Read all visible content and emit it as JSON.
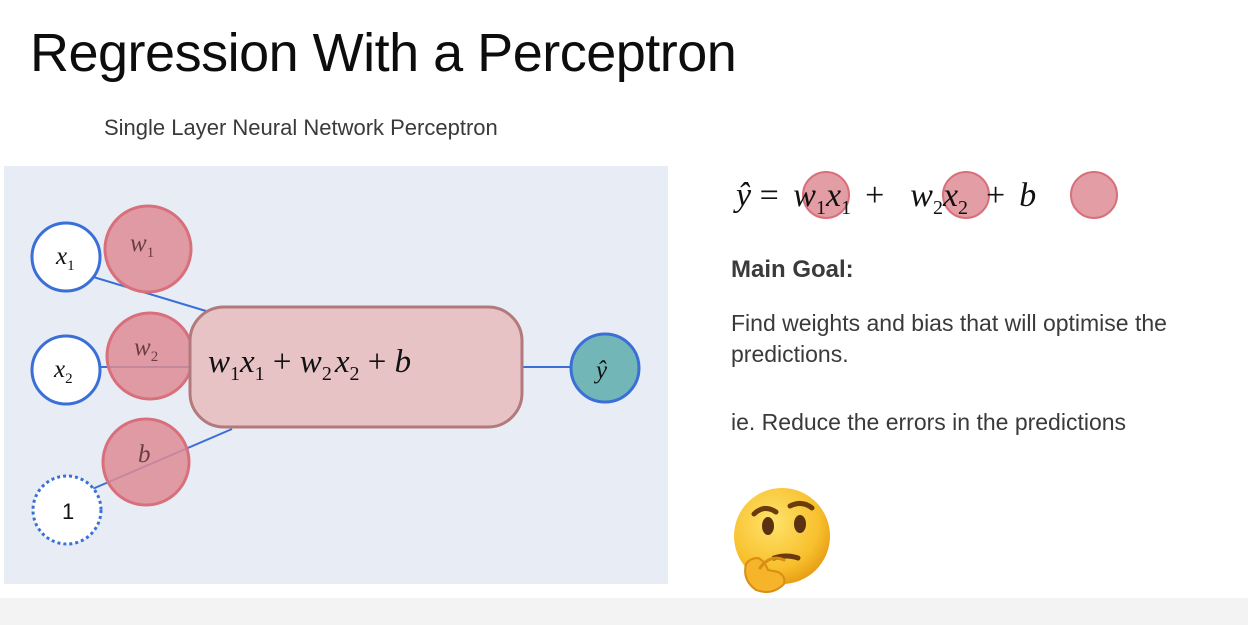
{
  "slide": {
    "title": "Regression With a Perceptron",
    "subtitle": "Single Layer Neural Network Perceptron"
  },
  "diagram": {
    "inputs": [
      {
        "base": "x",
        "sub": "1"
      },
      {
        "base": "x",
        "sub": "2"
      },
      {
        "base": "",
        "sub": "",
        "text": "1"
      }
    ],
    "weights": [
      {
        "base": "w",
        "sub": "1"
      },
      {
        "base": "w",
        "sub": "2"
      },
      {
        "base": "b",
        "sub": ""
      }
    ],
    "summation_terms": [
      "w1x1",
      "w2x2",
      "b"
    ],
    "output": {
      "base": "ŷ"
    },
    "colors": {
      "panel": "#e8ecf5",
      "weight_fill": "#de8c94",
      "weight_stroke": "#d8707c",
      "sum_fill": "#e8c3c6",
      "sum_stroke": "#b27a7c",
      "edge": "#3b6fd8",
      "output_fill": "#72b6b8"
    }
  },
  "equation": {
    "lhs": "ŷ",
    "terms": [
      {
        "weight": "w",
        "weight_sub": "1",
        "var": "x",
        "var_sub": "1"
      },
      {
        "weight": "w",
        "weight_sub": "2",
        "var": "x",
        "var_sub": "2"
      },
      {
        "weight": "b"
      }
    ]
  },
  "goal": {
    "heading": "Main Goal:",
    "text": "Find weights and bias that will optimise the predictions.",
    "subtext": "ie. Reduce the errors in the predictions",
    "emoji": "thinking-face"
  }
}
